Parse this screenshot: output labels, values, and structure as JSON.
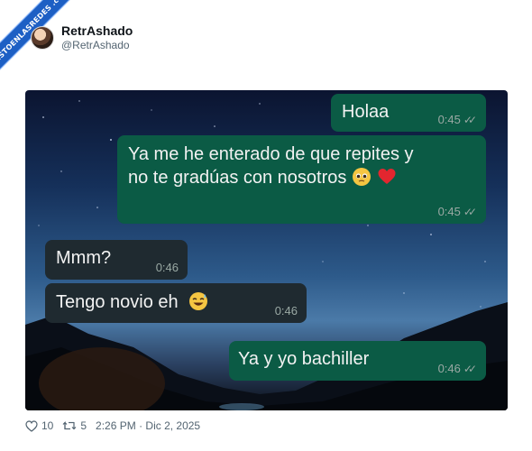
{
  "watermark": {
    "text": "VISTOENLASREDES .com"
  },
  "tweet": {
    "display_name": "RetrAshado",
    "handle": "@RetrAshado",
    "likes": "10",
    "retweets": "5",
    "timestamp": "2:26 PM · Dic 2, 2025"
  },
  "chat": {
    "messages": [
      {
        "side": "out",
        "text": "Holaa",
        "time": "0:45"
      },
      {
        "side": "out",
        "line1": "Ya me he enterado de que repites y",
        "line2": "no te gradúas con nosotros",
        "time": "0:45"
      },
      {
        "side": "in",
        "text": "Mmm?",
        "time": "0:46"
      },
      {
        "side": "in",
        "text": "Tengo novio eh",
        "time": "0:46"
      },
      {
        "side": "out",
        "text": "Ya y yo bachiller",
        "time": "0:46"
      }
    ]
  },
  "colors": {
    "outgoing_bubble": "#0b5b45",
    "incoming_bubble": "#1f2a30",
    "watermark": "#1d5fc4"
  }
}
